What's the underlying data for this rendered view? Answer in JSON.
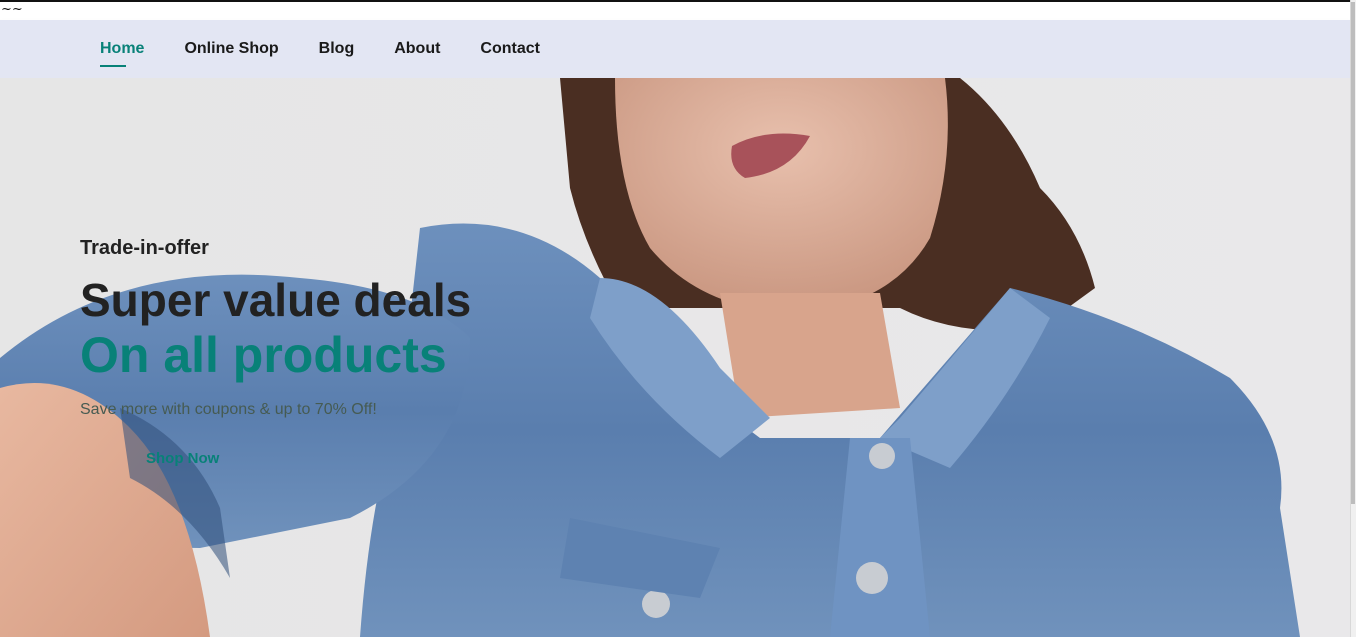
{
  "top_strip": {
    "text": "~~"
  },
  "nav": {
    "items": [
      {
        "label": "Home",
        "active": true
      },
      {
        "label": "Online Shop",
        "active": false
      },
      {
        "label": "Blog",
        "active": false
      },
      {
        "label": "About",
        "active": false
      },
      {
        "label": "Contact",
        "active": false
      }
    ]
  },
  "hero": {
    "subtitle": "Trade-in-offer",
    "heading": "Super value deals",
    "highlight": "On all products",
    "description": "Save more with coupons & up to 70% Off!",
    "button_label": "Shop Now"
  },
  "colors": {
    "accent": "#088178",
    "nav_background": "#e3e6f3",
    "hero_background": "#e4e4e4",
    "denim": "#5b7fae",
    "hair": "#4a2e22",
    "skin": "#d9a58c"
  }
}
